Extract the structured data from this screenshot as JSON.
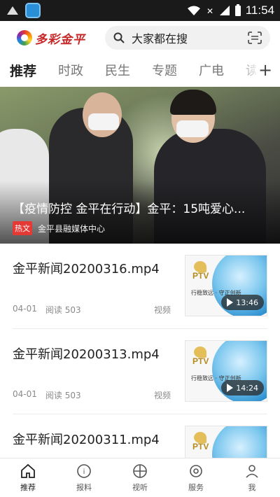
{
  "status_bar": {
    "time": "11:54"
  },
  "header": {
    "logo_text": "多彩金平",
    "search_placeholder": "大家都在搜"
  },
  "tabs": [
    {
      "label": "推荐",
      "active": true
    },
    {
      "label": "时政",
      "active": false
    },
    {
      "label": "民生",
      "active": false
    },
    {
      "label": "专题",
      "active": false
    },
    {
      "label": "广电",
      "active": false
    },
    {
      "label": "读",
      "active": false
    }
  ],
  "hero": {
    "title": "【疫情防控 金平在行动】金平：15吨爱心...",
    "tag": "热文",
    "source": "金平县融媒体中心"
  },
  "news": [
    {
      "title": "金平新闻20200316.mp4",
      "date": "04-01",
      "reads": "阅读 503",
      "type": "视频",
      "duration": "13:46",
      "thumb_logo": "PTV",
      "thumb_slogan": "行稳致远 · 守正创新"
    },
    {
      "title": "金平新闻20200313.mp4",
      "date": "04-01",
      "reads": "阅读 503",
      "type": "视频",
      "duration": "14:24",
      "thumb_logo": "PTV",
      "thumb_slogan": "行稳致远 · 守正创新"
    },
    {
      "title": "金平新闻20200311.mp4",
      "date": "",
      "reads": "",
      "type": "",
      "duration": "",
      "thumb_logo": "PTV",
      "thumb_slogan": ""
    }
  ],
  "bottom_nav": [
    {
      "label": "推荐",
      "icon": "home-icon",
      "active": true
    },
    {
      "label": "报料",
      "icon": "report-icon",
      "active": false
    },
    {
      "label": "视听",
      "icon": "media-icon",
      "active": false
    },
    {
      "label": "服务",
      "icon": "service-icon",
      "active": false
    },
    {
      "label": "我",
      "icon": "user-icon",
      "active": false
    }
  ],
  "colors": {
    "accent_red": "#e53935",
    "tab_active": "#222222",
    "tab_inactive": "#777777"
  }
}
